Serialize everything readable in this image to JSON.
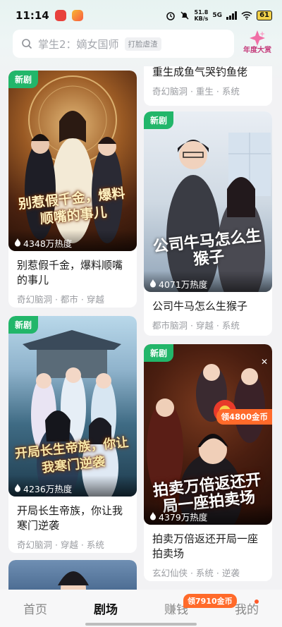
{
  "status_bar": {
    "time": "11:14",
    "net_speed": "51.8",
    "net_unit": "KB/s",
    "network": "5G",
    "battery": "61"
  },
  "search": {
    "placeholder": "掌生2：嫡女国师",
    "tag": "打脸虐渣"
  },
  "award": {
    "label": "年度大赏"
  },
  "cards": [
    {
      "tag": "新剧",
      "cover_title": "别惹假千金，爆料顺嘴的事儿",
      "heat": "4348万热度",
      "title": "别惹假千金，爆料顺嘴的事儿",
      "meta": "奇幻脑洞 · 都市 · 穿越"
    },
    {
      "tag": "新剧",
      "cover_title": "开局长生帝族，你让我寒门逆袭",
      "heat": "4236万热度",
      "title": "开局长生帝族，你让我寒门逆袭",
      "meta": "奇幻脑洞 · 穿越 · 系统"
    },
    {
      "title": "重生成鱼气哭钓鱼佬",
      "meta": "奇幻脑洞 · 重生 · 系统"
    },
    {
      "tag": "新剧",
      "cover_title": "公司牛马怎么生猴子",
      "heat": "4071万热度",
      "title": "公司牛马怎么生猴子",
      "meta": "都市脑洞 · 穿越 · 系统"
    },
    {
      "tag": "新剧",
      "cover_title": "拍卖万倍返还开局一座拍卖场",
      "coins": "领4800金币",
      "heat": "4379万热度",
      "title": "拍卖万倍返还开局一座拍卖场",
      "meta": "玄幻仙侠 · 系统 · 逆袭"
    }
  ],
  "nav": {
    "home": "首页",
    "theater": "剧场",
    "earn": "赚钱",
    "earn_badge": "领7910金币",
    "mine": "我的"
  },
  "colors": {
    "tag_green": "#22b66a",
    "coin_orange": "#ff6a2a"
  }
}
